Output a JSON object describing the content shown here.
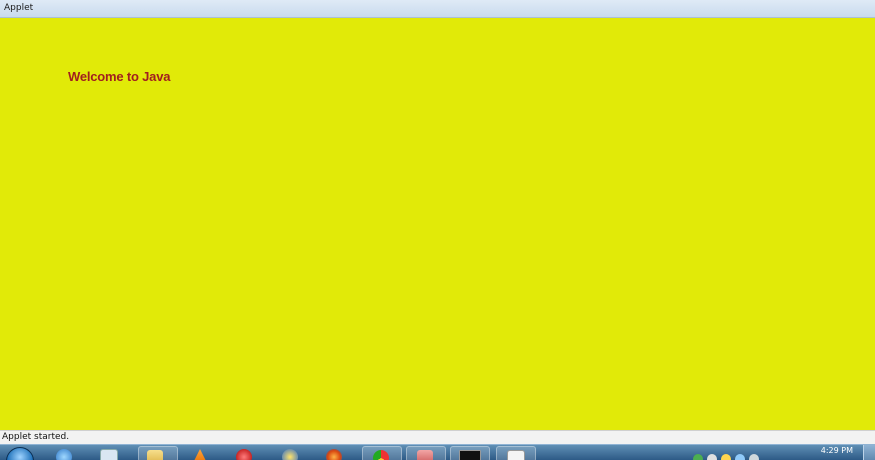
{
  "window": {
    "title": "Applet"
  },
  "applet": {
    "message": "Welcome to Java",
    "background_color": "#e1ea08",
    "text_color": "#a11f1f"
  },
  "status": {
    "text": "Applet started."
  },
  "taskbar": {
    "start_button": "start-orb-icon",
    "programs": [
      {
        "icon": "internet-explorer-icon",
        "active": false
      },
      {
        "icon": "media-player-icon",
        "active": false
      },
      {
        "icon": "folder-icon",
        "active": true
      },
      {
        "icon": "vlc-icon",
        "active": false
      },
      {
        "icon": "red-app-icon",
        "active": false
      },
      {
        "icon": "satellite-icon",
        "active": false
      },
      {
        "icon": "firefox-icon",
        "active": false
      },
      {
        "icon": "chrome-icon",
        "active": true
      },
      {
        "icon": "paint-icon",
        "active": true
      },
      {
        "icon": "command-prompt-icon",
        "active": true
      },
      {
        "icon": "java-icon",
        "active": true
      }
    ],
    "clock": "4:29 PM"
  }
}
